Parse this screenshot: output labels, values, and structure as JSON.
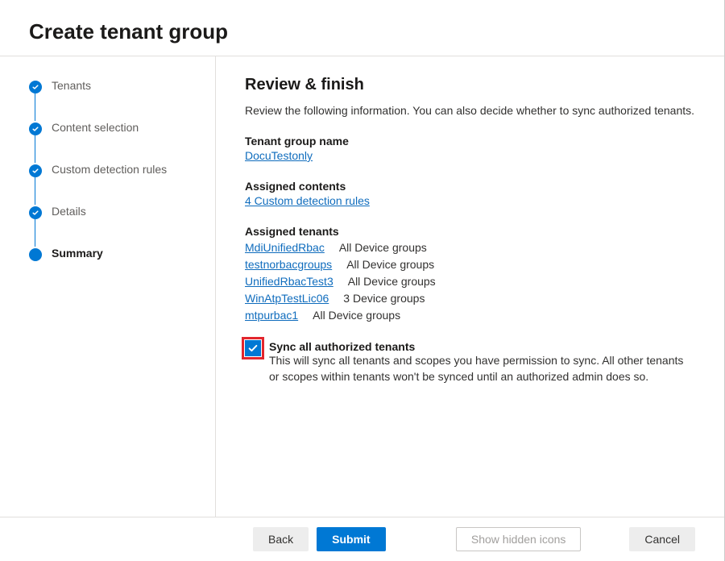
{
  "header": {
    "title": "Create tenant group"
  },
  "steps": [
    {
      "label": "Tenants",
      "state": "done"
    },
    {
      "label": "Content selection",
      "state": "done"
    },
    {
      "label": "Custom detection rules",
      "state": "done"
    },
    {
      "label": "Details",
      "state": "done"
    },
    {
      "label": "Summary",
      "state": "current"
    }
  ],
  "review": {
    "heading": "Review & finish",
    "intro": "Review the following information. You can also decide whether to sync authorized tenants.",
    "tenant_group_label": "Tenant group name",
    "tenant_group_value": "DocuTestonly",
    "assigned_contents_label": "Assigned contents",
    "assigned_contents_value": "4 Custom detection rules",
    "assigned_tenants_label": "Assigned tenants",
    "tenants": [
      {
        "name": "MdiUnifiedRbac",
        "scope": "All Device groups"
      },
      {
        "name": "testnorbacgroups",
        "scope": "All Device groups"
      },
      {
        "name": "UnifiedRbacTest3",
        "scope": "All Device groups"
      },
      {
        "name": "WinAtpTestLic06",
        "scope": "3 Device groups"
      },
      {
        "name": "mtpurbac1",
        "scope": "All Device groups"
      }
    ],
    "sync": {
      "checked": true,
      "title": "Sync all authorized tenants",
      "desc": "This will sync all tenants and scopes you have permission to sync. All other tenants or scopes within tenants won't be synced until an authorized admin does so."
    }
  },
  "footer": {
    "back": "Back",
    "submit": "Submit",
    "show_hidden": "Show hidden icons",
    "cancel": "Cancel"
  }
}
